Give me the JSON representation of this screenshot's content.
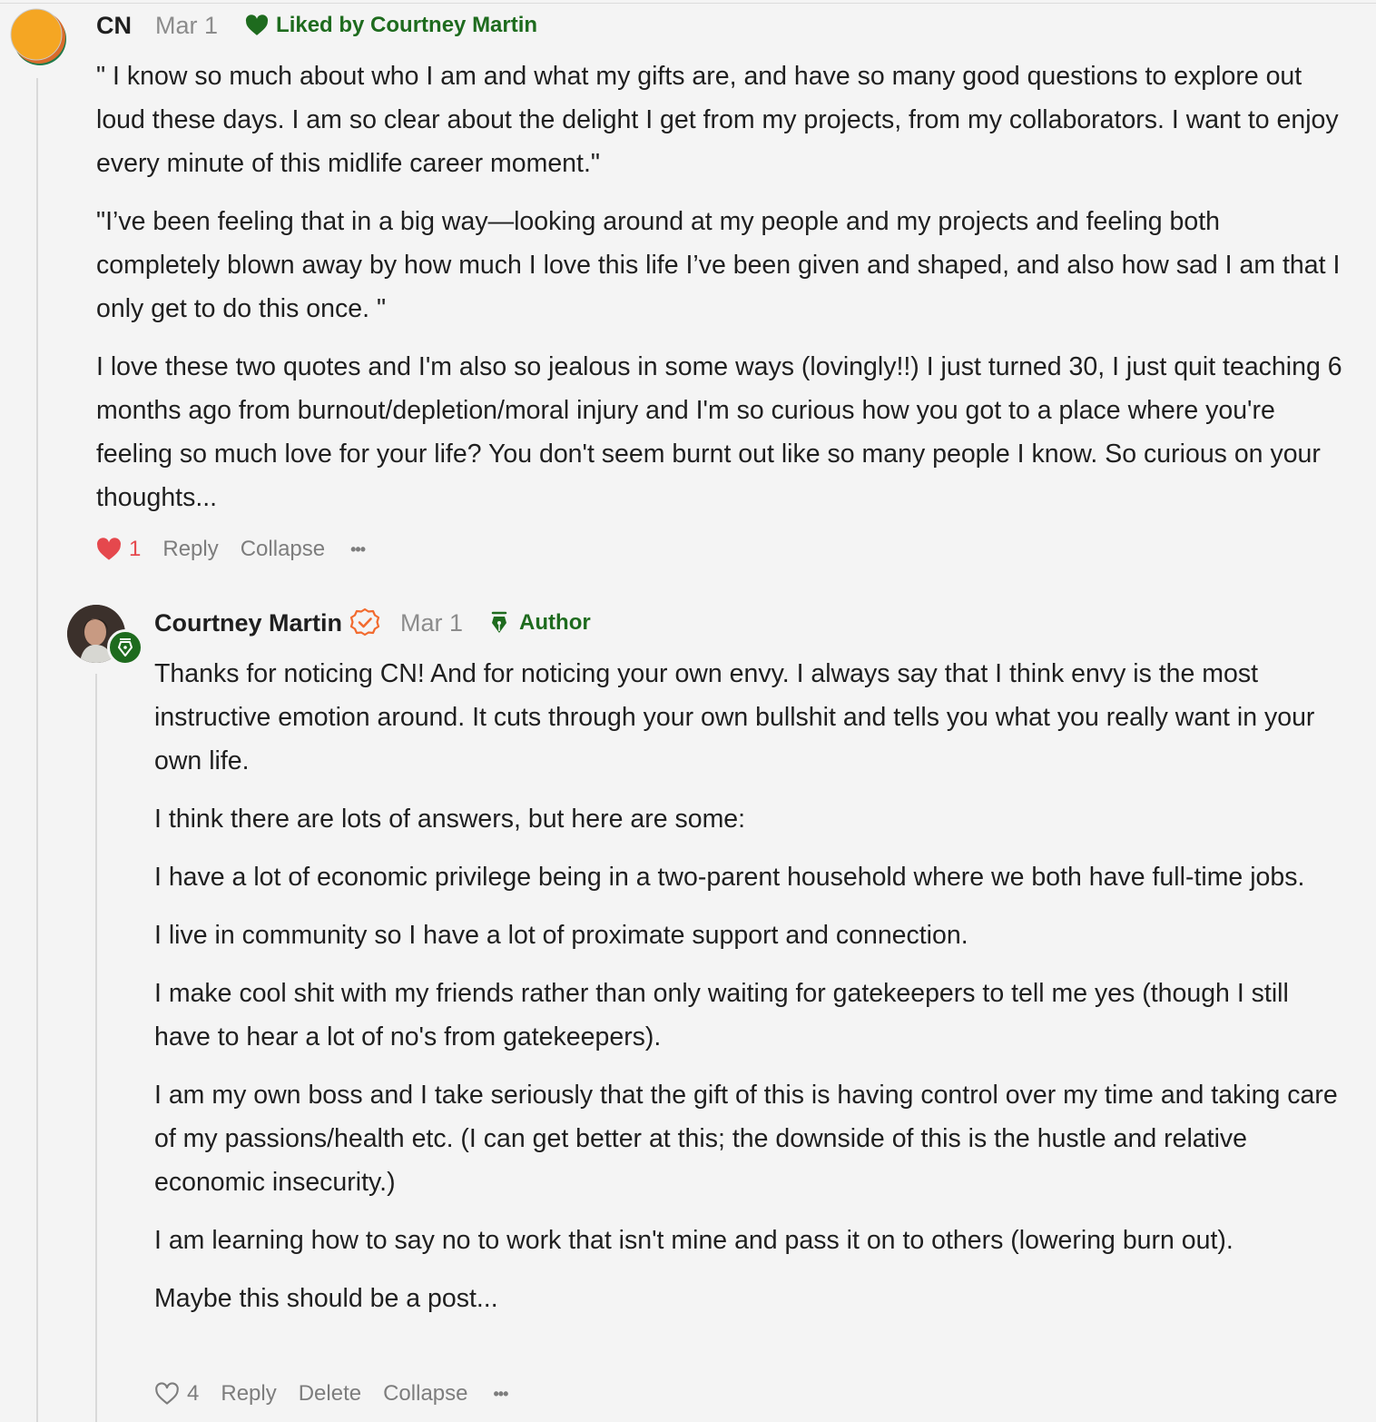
{
  "colors": {
    "background": "#f4f4f4",
    "accent_green": "#1e6b1e",
    "heart_red": "#e5484d",
    "muted": "#8c8c8c",
    "verified_orange": "#f26a2e"
  },
  "comment1": {
    "author": "CN",
    "date": "Mar 1",
    "liked_by": "Liked by Courtney Martin",
    "paragraphs": [
      "\" I know so much about who I am and what my gifts are, and have so many good questions to explore out loud these days. I am so clear about the delight I get from my projects, from my collaborators. I want to enjoy every minute of this midlife career moment.\"",
      "\"I’ve been feeling that in a big way—looking around at my people and my projects and feeling both completely blown away by how much I love this life I’ve been given and shaped, and also how sad I am that I only get to do this once. \"",
      "I love these two quotes and I'm also so jealous in some ways (lovingly!!) I just turned 30, I just quit teaching 6 months ago from burnout/depletion/moral injury and I'm so curious how you got to a place where you're feeling so much love for your life? You don't seem burnt out like so many people I know. So curious on your thoughts..."
    ],
    "like_count": "1",
    "reply_label": "Reply",
    "collapse_label": "Collapse",
    "more_label": "•••"
  },
  "comment2": {
    "author": "Courtney Martin",
    "date": "Mar 1",
    "badge_label": "Author",
    "paragraphs": [
      "Thanks for noticing CN! And for noticing your own envy. I always say that I think envy is the most instructive emotion around. It cuts through your own bullshit and tells you what you really want in your own life.",
      "I think there are lots of answers, but here are some:",
      "I have a lot of economic privilege being in a two-parent household where we both have full-time jobs.",
      "I live in community so I have a lot of proximate support and connection.",
      "I make cool shit with my friends rather than only waiting for gatekeepers to tell me yes (though I still have to hear a lot of no's from gatekeepers).",
      "I am my own boss and I take seriously that the gift of this is having control over my time and taking care of my passions/health etc. (I can get better at this; the downside of this is the hustle and relative economic insecurity.)",
      "I am learning how to say no to work that isn't mine and pass it on to others (lowering burn out).",
      "Maybe this should be a post..."
    ],
    "like_count": "4",
    "reply_label": "Reply",
    "delete_label": "Delete",
    "collapse_label": "Collapse",
    "more_label": "•••"
  },
  "icons": {
    "liked": "heart-icon",
    "author": "pen-nib-icon",
    "verified": "check-circle-icon",
    "like_filled": "heart-filled-icon",
    "like_outline": "heart-outline-icon",
    "more": "ellipsis-icon"
  }
}
